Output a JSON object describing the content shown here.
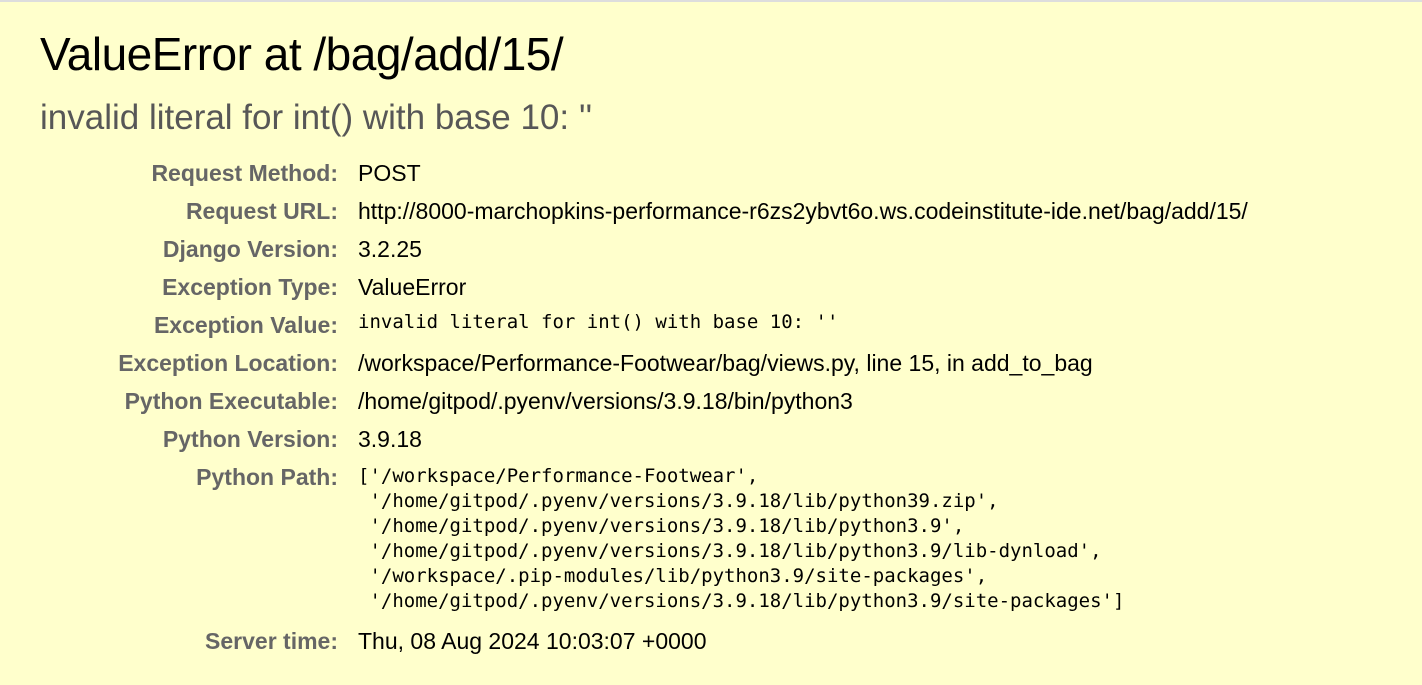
{
  "title": "ValueError at /bag/add/15/",
  "exception_value": "invalid literal for int() with base 10: ''",
  "meta": {
    "request_method": {
      "label": "Request Method:",
      "value": "POST"
    },
    "request_url": {
      "label": "Request URL:",
      "value": "http://8000-marchopkins-performance-r6zs2ybvt6o.ws.codeinstitute-ide.net/bag/add/15/"
    },
    "django_version": {
      "label": "Django Version:",
      "value": "3.2.25"
    },
    "exception_type": {
      "label": "Exception Type:",
      "value": "ValueError"
    },
    "exception_value": {
      "label": "Exception Value:",
      "value": "invalid literal for int() with base 10: ''"
    },
    "exception_location": {
      "label": "Exception Location:",
      "value": "/workspace/Performance-Footwear/bag/views.py, line 15, in add_to_bag"
    },
    "python_executable": {
      "label": "Python Executable:",
      "value": "/home/gitpod/.pyenv/versions/3.9.18/bin/python3"
    },
    "python_version": {
      "label": "Python Version:",
      "value": "3.9.18"
    },
    "python_path": {
      "label": "Python Path:",
      "value": "['/workspace/Performance-Footwear',\n '/home/gitpod/.pyenv/versions/3.9.18/lib/python39.zip',\n '/home/gitpod/.pyenv/versions/3.9.18/lib/python3.9',\n '/home/gitpod/.pyenv/versions/3.9.18/lib/python3.9/lib-dynload',\n '/workspace/.pip-modules/lib/python3.9/site-packages',\n '/home/gitpod/.pyenv/versions/3.9.18/lib/python3.9/site-packages']"
    },
    "server_time": {
      "label": "Server time:",
      "value": "Thu, 08 Aug 2024 10:03:07 +0000"
    }
  },
  "colors": {
    "background": "#ffffcc",
    "label": "#666666",
    "subtitle": "#575757"
  }
}
